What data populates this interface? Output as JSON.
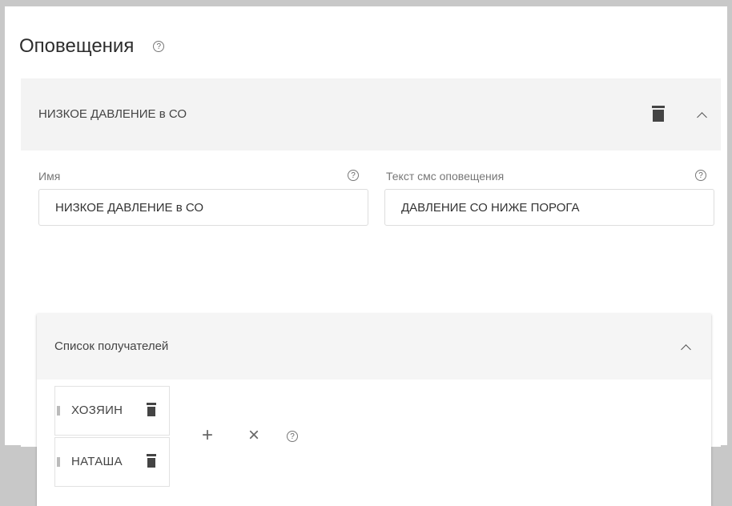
{
  "header": {
    "title": "Оповещения",
    "help_glyph": "?"
  },
  "alert": {
    "title": "НИЗКОЕ ДАВЛЕНИЕ в СО",
    "name_label": "Имя",
    "name_value": "НИЗКОЕ ДАВЛЕНИЕ в СО",
    "sms_label": "Текст смс оповещения",
    "sms_value": "ДАВЛЕНИЕ СО НИЖЕ ПОРОГА",
    "help_glyph": "?"
  },
  "recipients": {
    "label": "Список получателей",
    "items": [
      "ХОЗЯИН",
      "НАТАША"
    ],
    "add_glyph": "+",
    "clear_glyph": "×",
    "help_glyph": "?"
  },
  "icons": {
    "help": "help-circle-icon",
    "delete": "trash-icon",
    "collapse": "chevron-up-icon",
    "drag": "drag-handle-icon"
  },
  "colors": {
    "panel_bg": "#f3f3f3",
    "icon": "#444444",
    "border": "#dddddd"
  }
}
